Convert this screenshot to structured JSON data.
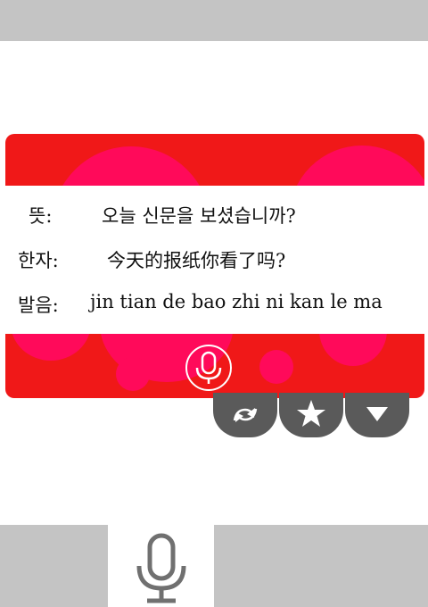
{
  "card": {
    "meaning_label": "뜻:",
    "meaning_value": "오늘 신문을 보셨습니까?",
    "hanja_label": "한자:",
    "hanja_value": "今天的报纸你看了吗?",
    "pronunciation_label": "발음:",
    "pronunciation_value": "jin tian de bao zhi ni kan le ma"
  },
  "colors": {
    "card_background": "#f01818",
    "card_bubbles": "#ff0a5a",
    "action_buttons": "#5a5a5a",
    "bars": "#c4c4c4"
  },
  "icons": {
    "card_mic": "microphone-icon",
    "refresh": "refresh-icon",
    "favorite": "star-icon",
    "more": "triangle-down-icon",
    "bottom_mic": "microphone-icon"
  }
}
